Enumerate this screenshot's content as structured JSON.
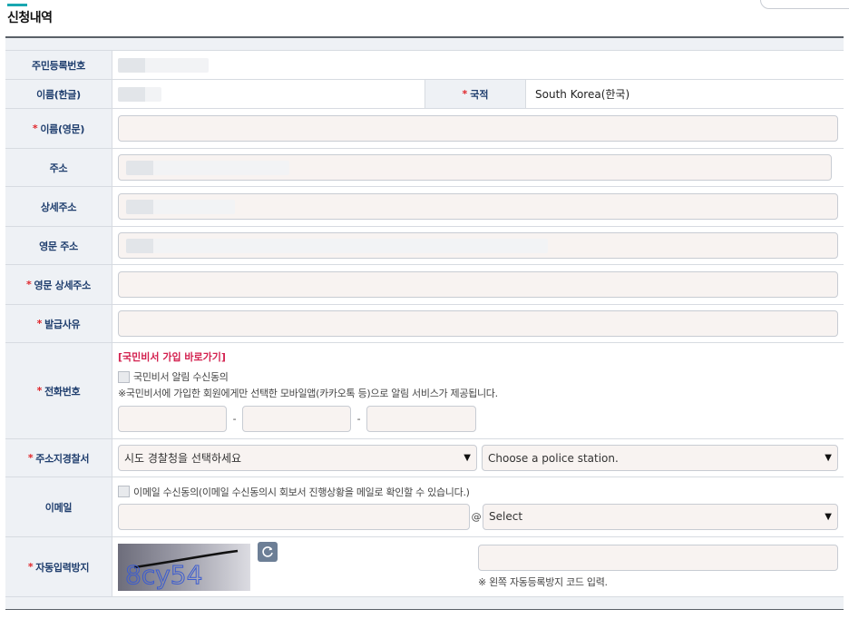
{
  "page": {
    "title": "신청내역"
  },
  "rows": {
    "rrn": {
      "label": "주민등록번호"
    },
    "name_kr": {
      "label": "이름(한글)"
    },
    "nationality": {
      "label": "국적",
      "value": "South Korea(한국)"
    },
    "name_en": {
      "label": "이름(영문)"
    },
    "address": {
      "label": "주소"
    },
    "address_detail": {
      "label": "상세주소"
    },
    "address_en": {
      "label": "영문 주소"
    },
    "address_en_detail": {
      "label": "영문 상세주소"
    },
    "reason": {
      "label": "발급사유"
    },
    "phone": {
      "label": "전화번호",
      "link": "[국민비서 가입 바로가기]",
      "consent": "국민비서 알림 수신동의",
      "note": "※국민비서에 가입한 회원에게만 선택한 모바일앱(카카오톡 등)으로 알림 서비스가 제공됩니다.",
      "sep": "-"
    },
    "police": {
      "label": "주소지경찰서",
      "province_selected": "시도 경찰청을 선택하세요",
      "station_selected": "Choose a police station."
    },
    "email": {
      "label": "이메일",
      "consent": "이메일 수신동의(이메일 수신동의시 회보서 진행상황을 메일로 확인할 수 있습니다.)",
      "at": "@",
      "domain_selected": "Select"
    },
    "captcha": {
      "label": "자동입력방지",
      "image_text": "8cy54",
      "note": "※ 왼쪽 자동등록방지 코드 입력."
    }
  },
  "required_mark": "*",
  "colors": {
    "accent": "#19a7b0",
    "label": "#1f3e6e",
    "required": "#e0262b",
    "link": "#d3214f",
    "input_bg": "#f8f3f1"
  }
}
